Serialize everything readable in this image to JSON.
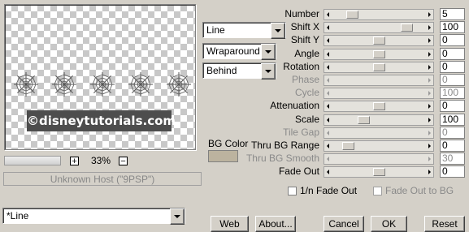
{
  "preview": {
    "watermark": "©disneytutorials.com",
    "web_count": 5
  },
  "zoom": {
    "value": "33%",
    "plus": "+",
    "minus": "−"
  },
  "status_text": "Unknown Host (\"9PSP\")",
  "combos": {
    "type": "Line",
    "edge": "Wraparound",
    "order": "Behind"
  },
  "bgcolor": {
    "label": "BG Color",
    "color": "#bcb39f"
  },
  "params": [
    {
      "label": "Number",
      "value": "5",
      "enabled": true,
      "level": 0.2
    },
    {
      "label": "Shift X",
      "value": "100",
      "enabled": true,
      "level": 0.82
    },
    {
      "label": "Shift Y",
      "value": "0",
      "enabled": true,
      "level": 0.5
    },
    {
      "label": "Angle",
      "value": "0",
      "enabled": true,
      "level": 0.5
    },
    {
      "label": "Rotation",
      "value": "0",
      "enabled": true,
      "level": 0.5
    },
    {
      "label": "Phase",
      "value": "0",
      "enabled": false,
      "level": null
    },
    {
      "label": "Cycle",
      "value": "100",
      "enabled": false,
      "level": null
    },
    {
      "label": "Attenuation",
      "value": "0",
      "enabled": true,
      "level": 0.5
    },
    {
      "label": "Scale",
      "value": "100",
      "enabled": true,
      "level": 0.33
    },
    {
      "label": "Tile Gap",
      "value": "0",
      "enabled": false,
      "level": null
    },
    {
      "label": "Thru BG Range",
      "value": "0",
      "enabled": true,
      "level": 0.15
    },
    {
      "label": "Thru BG Smooth",
      "value": "30",
      "enabled": false,
      "level": null
    },
    {
      "label": "Fade Out",
      "value": "0",
      "enabled": true,
      "level": 0.5
    }
  ],
  "checks": {
    "fade_in": "1/n Fade Out",
    "fade_to_bg": "Fade Out to BG"
  },
  "preset": "*Line",
  "buttons": {
    "web": "Web",
    "about": "About...",
    "cancel": "Cancel",
    "ok": "OK",
    "reset": "Reset"
  }
}
